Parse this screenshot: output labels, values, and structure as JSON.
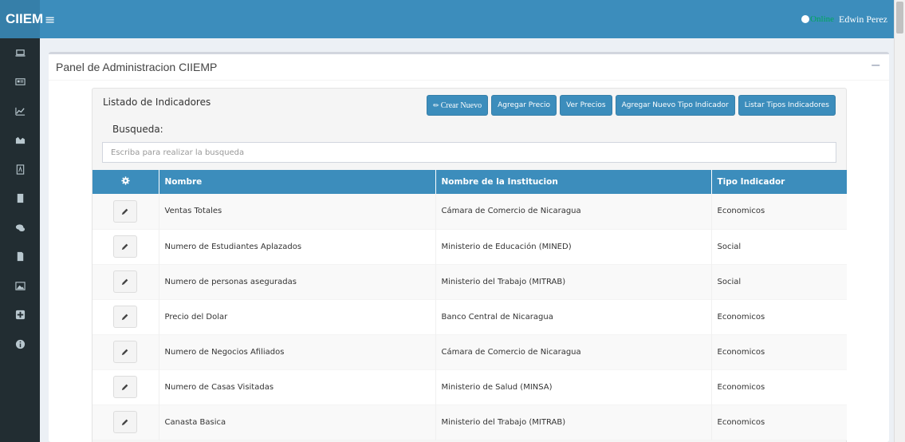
{
  "header": {
    "logo": "CIIEM",
    "menu_icon": "hamburger-icon",
    "status": "Online",
    "user": "Edwin Perez"
  },
  "sidebar": {
    "icons": [
      "laptop-icon",
      "id-card-icon",
      "line-chart-icon",
      "area-chart-icon",
      "pdf-file-icon",
      "building-icon",
      "comments-icon",
      "file-icon",
      "image-icon",
      "plus-square-icon",
      "info-circle-icon"
    ]
  },
  "panel": {
    "title": "Panel de Administracion CIIEMP",
    "collapse": "−"
  },
  "list": {
    "title": "Listado de Indicadores",
    "buttons": {
      "create": "Crear Nuevo",
      "add_price": "Agregar Precio",
      "view_prices": "Ver Precios",
      "add_type": "Agregar Nuevo Tipo Indicador",
      "list_types": "Listar Tipos Indicadores"
    },
    "search_label": "Busqueda:",
    "search_placeholder": "Escriba para realizar la busqueda",
    "columns": {
      "settings_icon": "gear-icon",
      "name": "Nombre",
      "institution": "Nombre de la Institucion",
      "type": "Tipo Indicador"
    },
    "rows": [
      {
        "name": "Ventas Totales",
        "institution": "Cámara de Comercio de Nicaragua",
        "type": "Economicos"
      },
      {
        "name": "Numero de Estudiantes Aplazados",
        "institution": "Ministerio de Educación (MINED)",
        "type": "Social"
      },
      {
        "name": "Numero de personas aseguradas",
        "institution": "Ministerio del Trabajo (MITRAB)",
        "type": "Social"
      },
      {
        "name": "Precio del Dolar",
        "institution": "Banco Central de Nicaragua",
        "type": "Economicos"
      },
      {
        "name": "Numero de Negocios Afiliados",
        "institution": "Cámara de Comercio de Nicaragua",
        "type": "Economicos"
      },
      {
        "name": "Numero de Casas Visitadas",
        "institution": "Ministerio de Salud (MINSA)",
        "type": "Economicos"
      },
      {
        "name": "Canasta Basica",
        "institution": "Ministerio del Trabajo (MITRAB)",
        "type": "Economicos"
      }
    ]
  },
  "colors": {
    "primary": "#3c8dbc",
    "sidebar": "#222d32",
    "online": "#00a65a"
  }
}
